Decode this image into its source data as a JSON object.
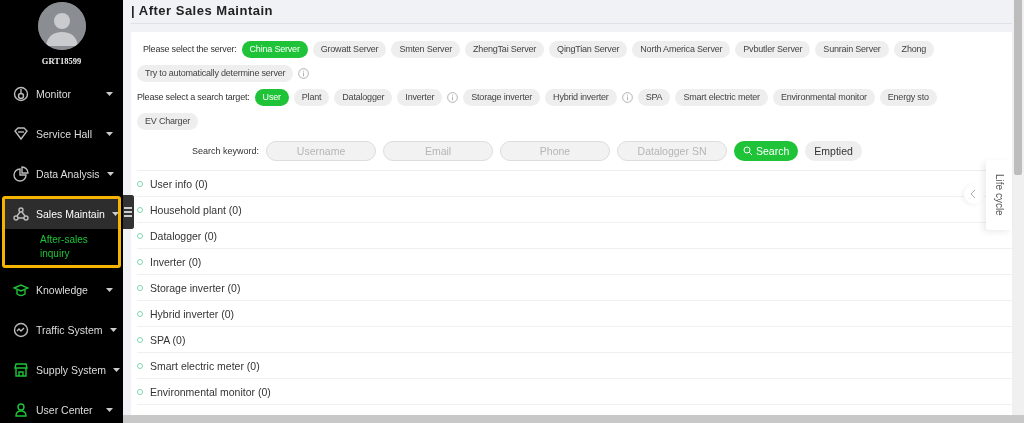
{
  "user": {
    "name": "GRT18599"
  },
  "menu": [
    {
      "label": "Monitor",
      "expanded": false,
      "highlighted": false
    },
    {
      "label": "Service Hall",
      "expanded": false,
      "highlighted": false
    },
    {
      "label": "Data Analysis",
      "expanded": false,
      "highlighted": false
    },
    {
      "label": "Sales Maintain",
      "expanded": true,
      "highlighted": true,
      "children": [
        {
          "label": "After-sales inquiry",
          "selected": true
        }
      ]
    },
    {
      "label": "Knowledge",
      "expanded": false,
      "highlighted": false
    },
    {
      "label": "Traffic System",
      "expanded": false,
      "highlighted": false
    },
    {
      "label": "Supply System",
      "expanded": false,
      "highlighted": false
    },
    {
      "label": "User Center",
      "expanded": false,
      "highlighted": false
    }
  ],
  "page": {
    "title": "| After Sales Maintain"
  },
  "servers": {
    "label": "Please select the server:",
    "options": [
      {
        "label": "China Server",
        "selected": true,
        "info": false
      },
      {
        "label": "Growatt Server",
        "selected": false,
        "info": false
      },
      {
        "label": "Smten Server",
        "selected": false,
        "info": false
      },
      {
        "label": "ZhengTai Server",
        "selected": false,
        "info": false
      },
      {
        "label": "QingTian Server",
        "selected": false,
        "info": false
      },
      {
        "label": "North America Server",
        "selected": false,
        "info": false
      },
      {
        "label": "Pvbutler Server",
        "selected": false,
        "info": false
      },
      {
        "label": "Sunrain Server",
        "selected": false,
        "info": false
      },
      {
        "label": "Zhong",
        "selected": false,
        "info": false
      },
      {
        "label": "Try to automatically determine server",
        "selected": false,
        "info": true
      }
    ]
  },
  "targets": {
    "label": "Please select a search target:",
    "options": [
      {
        "label": "User",
        "selected": true,
        "info": false
      },
      {
        "label": "Plant",
        "selected": false,
        "info": false
      },
      {
        "label": "Datalogger",
        "selected": false,
        "info": false
      },
      {
        "label": "Inverter",
        "selected": false,
        "info": true
      },
      {
        "label": "Storage inverter",
        "selected": false,
        "info": false
      },
      {
        "label": "Hybrid inverter",
        "selected": false,
        "info": true
      },
      {
        "label": "SPA",
        "selected": false,
        "info": false
      },
      {
        "label": "Smart electric meter",
        "selected": false,
        "info": false
      },
      {
        "label": "Environmental monitor",
        "selected": false,
        "info": false
      },
      {
        "label": "Energy sto",
        "selected": false,
        "info": false
      },
      {
        "label": "EV Charger",
        "selected": false,
        "info": false
      }
    ]
  },
  "keyword": {
    "label": "Search keyword:",
    "fields": [
      {
        "placeholder": "Username"
      },
      {
        "placeholder": "Email"
      },
      {
        "placeholder": "Phone"
      },
      {
        "placeholder": "Datalogger SN"
      }
    ],
    "buttons": [
      {
        "label": "Search",
        "kind": "primary"
      },
      {
        "label": "Emptied",
        "kind": "plain"
      }
    ]
  },
  "results": [
    "User info (0)",
    "Household plant (0)",
    "Datalogger (0)",
    "Inverter (0)",
    "Storage inverter (0)",
    "Hybrid inverter (0)",
    "SPA (0)",
    "Smart electric meter (0)",
    "Environmental monitor (0)"
  ],
  "side_tab": {
    "label": "Life cycle"
  }
}
